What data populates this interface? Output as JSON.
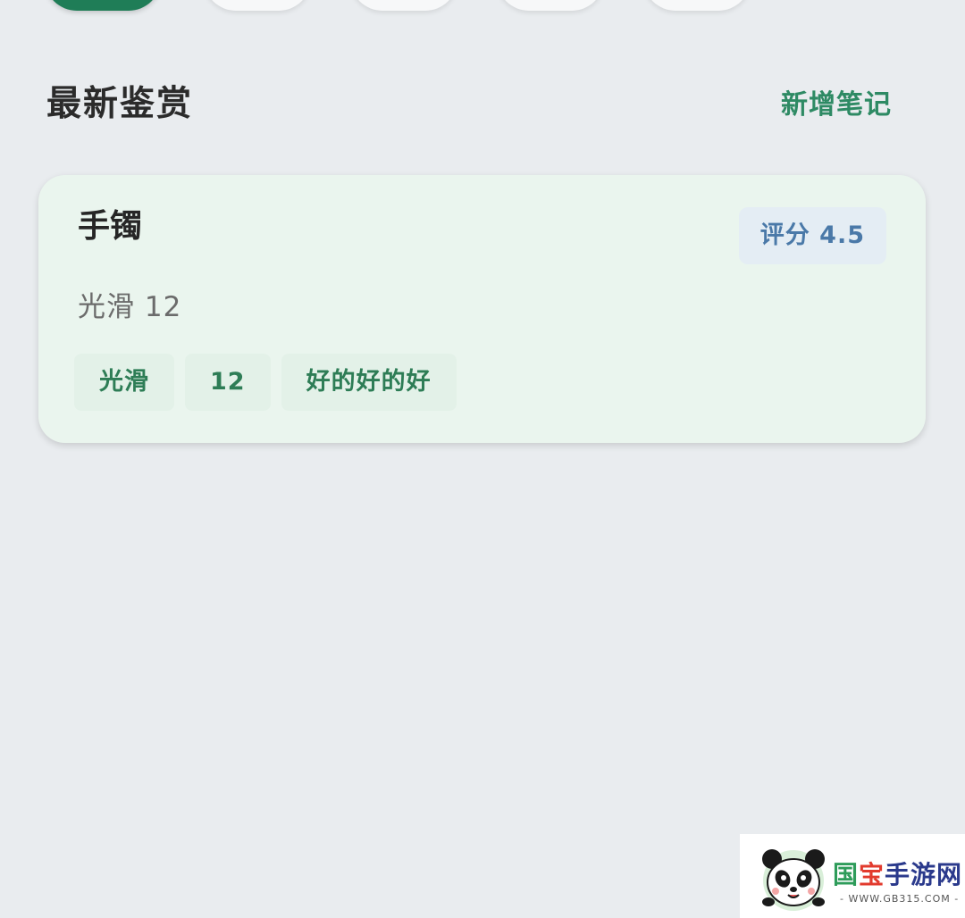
{
  "section": {
    "title": "最新鉴赏",
    "add_note_label": "新增笔记"
  },
  "card": {
    "title": "手镯",
    "score_label": "评分 4.5",
    "summary": "光滑 12",
    "tags": [
      "光滑",
      "12",
      "好的好的好"
    ]
  },
  "watermark": {
    "brand_1": "国",
    "brand_2": "宝",
    "brand_3": "手游网",
    "url": "- WWW.GB315.COM -"
  },
  "colors": {
    "background": "#e9ecef",
    "accent": "#2e8a64",
    "active_chip": "#1f7d57",
    "card_bg": "#eaf5ee",
    "score_text": "#4a79a8",
    "score_bg": "#e4edf4"
  }
}
